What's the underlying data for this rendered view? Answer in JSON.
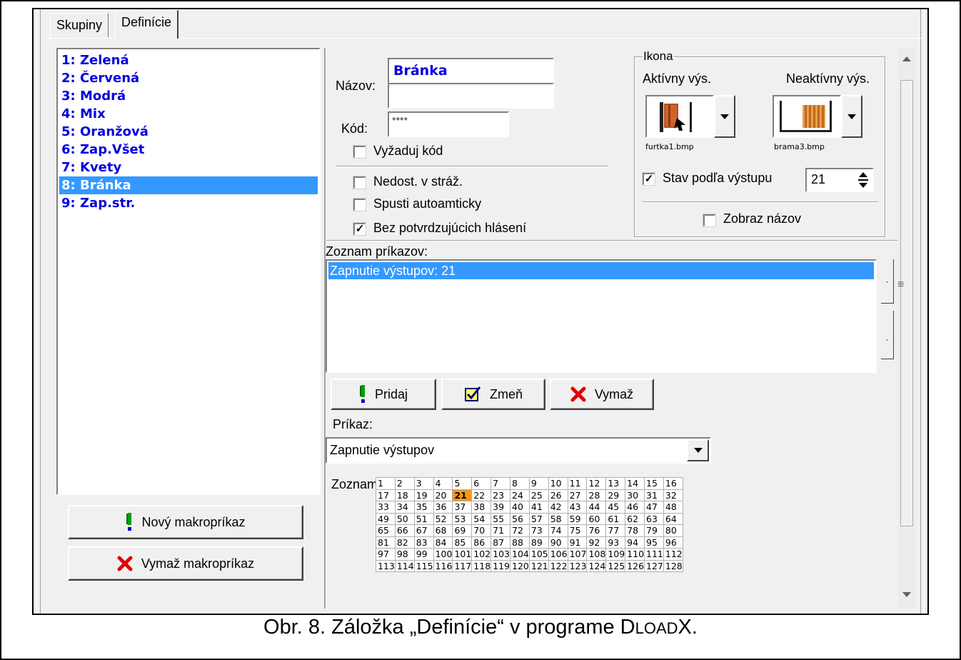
{
  "tabs": [
    {
      "label": "Skupiny",
      "active": false
    },
    {
      "label": "Definície",
      "active": true
    }
  ],
  "macro_list": [
    {
      "label": "1: Zelená",
      "selected": false
    },
    {
      "label": "2: Červená",
      "selected": false
    },
    {
      "label": "3: Modrá",
      "selected": false
    },
    {
      "label": "4: Mix",
      "selected": false
    },
    {
      "label": "5: Oranžová",
      "selected": false
    },
    {
      "label": "6: Zap.Všet",
      "selected": false
    },
    {
      "label": "7: Kvety",
      "selected": false
    },
    {
      "label": "8: Bránka",
      "selected": true
    },
    {
      "label": "9: Zap.str.",
      "selected": false
    }
  ],
  "left_buttons": {
    "new_label": "Nový makropríkaz",
    "delete_label": "Vymaž makropríkaz"
  },
  "form": {
    "name_label": "Názov:",
    "name_line1": "Bránka",
    "name_line2": "",
    "code_label": "Kód:",
    "code_value": "****",
    "require_code": {
      "label": "Vyžaduj kód",
      "checked": false
    },
    "unavail_armed": {
      "label": "Nedost. v stráž.",
      "checked": false
    },
    "auto_run": {
      "label": "Spusti autoamticky",
      "checked": false
    },
    "no_confirm": {
      "label": "Bez potvrdzujúcich hlásení",
      "checked": true
    }
  },
  "icon_group": {
    "title": "Ikona",
    "active_label": "Aktívny výs.",
    "inactive_label": "Neaktívny výs.",
    "active_file": "furtka1.bmp",
    "inactive_file": "brama3.bmp",
    "state_by_output": {
      "label": "Stav podľa výstupu",
      "checked": true,
      "value": "21"
    },
    "show_name": {
      "label": "Zobraz názov",
      "checked": false
    }
  },
  "commands": {
    "list_label": "Zoznam príkazov:",
    "items": [
      "Zapnutie výstupov: 21"
    ],
    "add_label": "Pridaj",
    "change_label": "Zmeň",
    "delete_label": "Vymaž",
    "command_label": "Príkaz:",
    "command_value": "Zapnutie výstupov",
    "outputs_label": "Zoznam",
    "selected_outputs": [
      21
    ]
  },
  "caption": {
    "prefix": "Obr. 8. Záložka „Definície“ v programe D",
    "small1": "LOAD",
    "suffix": "X."
  },
  "colors": {
    "selection": "#3399ff",
    "list_text": "#0000e0",
    "grid_on": "#f09a18",
    "pridaj_icon": "#00a000",
    "vymaz_icon": "#e00000"
  }
}
